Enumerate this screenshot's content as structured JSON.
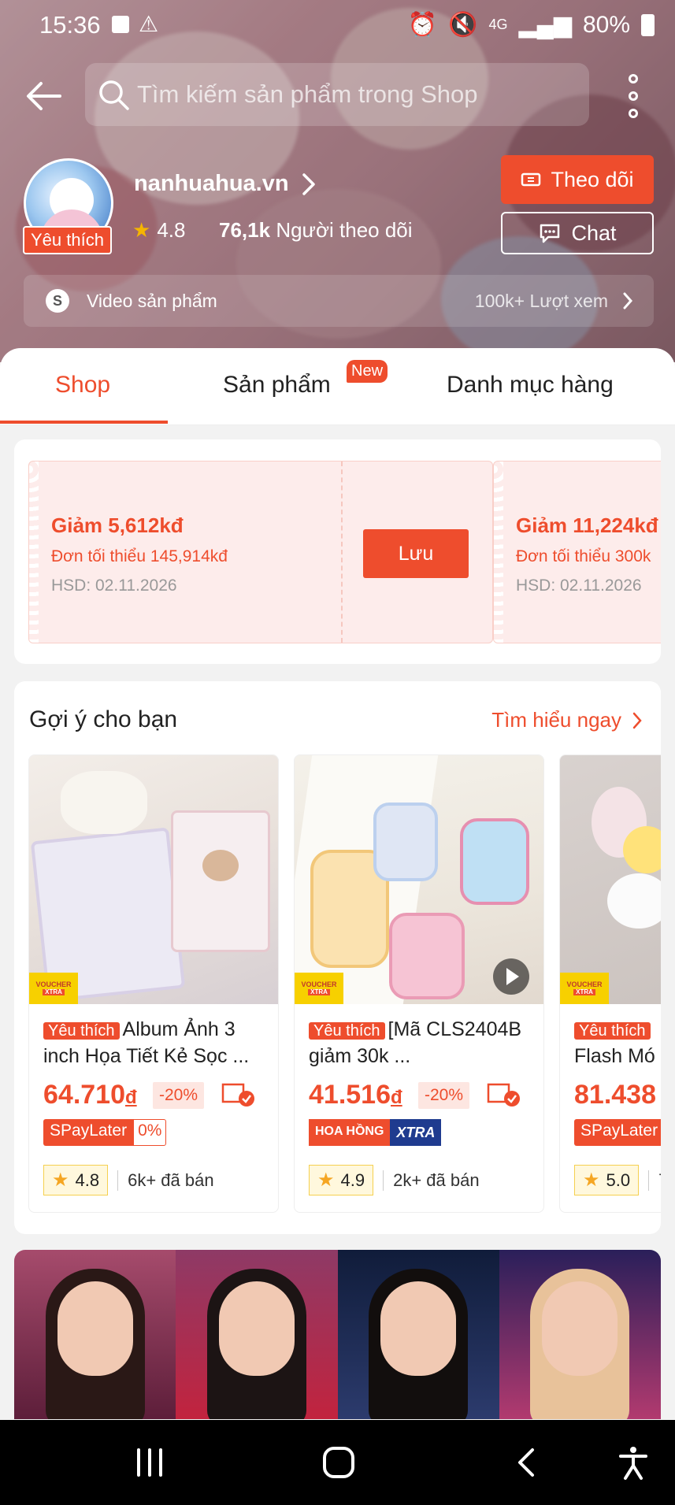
{
  "status_bar": {
    "time": "15:36",
    "battery": "80%",
    "network": "4G"
  },
  "search": {
    "placeholder": "Tìm kiếm sản phẩm trong Shop"
  },
  "shop": {
    "name": "nanhuahua.vn",
    "badge": "Yêu thích",
    "rating": "4.8",
    "followers_count": "76,1k",
    "followers_label": "Người theo dõi",
    "follow_label": "Theo dõi",
    "chat_label": "Chat"
  },
  "video_bar": {
    "label": "Video sản phẩm",
    "views": "100k+ Lượt xem"
  },
  "tabs": [
    {
      "label": "Shop",
      "active": true
    },
    {
      "label": "Sản phẩm",
      "badge": "New"
    },
    {
      "label": "Danh mục hàng"
    }
  ],
  "vouchers": [
    {
      "title": "Giảm 5,612kđ",
      "min_order": "Đơn tối thiểu 145,914kđ",
      "expiry": "HSD: 02.11.2026",
      "button": "Lưu"
    },
    {
      "title": "Giảm 11,224kđ",
      "min_order": "Đơn tối thiểu 300k",
      "expiry": "HSD: 02.11.2026"
    }
  ],
  "suggestions": {
    "title": "Gợi ý cho bạn",
    "more_label": "Tìm hiểu ngay",
    "voucher_badge_top": "VOUCHER",
    "voucher_badge_bottom": "XTRA",
    "products": [
      {
        "badge": "Yêu thích",
        "name": "Album Ảnh 3 inch Họa Tiết Kẻ Sọc ...",
        "price": "64.710",
        "currency": "đ",
        "discount": "-20%",
        "tag": "SPayLater",
        "tag_pct": "0%",
        "rating": "4.8",
        "sold": "6k+ đã bán"
      },
      {
        "badge": "Yêu thích",
        "name": "[Mã CLS2404B giảm 30k ...",
        "price": "41.516",
        "currency": "đ",
        "discount": "-20%",
        "tag_a": "HOA HỒNG",
        "tag_b": "XTRA",
        "rating": "4.9",
        "sold": "2k+ đã bán"
      },
      {
        "badge": "Yêu thích",
        "name": "Flash Mó",
        "price": "81.438",
        "tag": "SPayLater",
        "rating": "5.0",
        "sold": "7"
      }
    ]
  },
  "colors": {
    "brand": "#ee4d2d",
    "rating_star": "#f5a623"
  }
}
